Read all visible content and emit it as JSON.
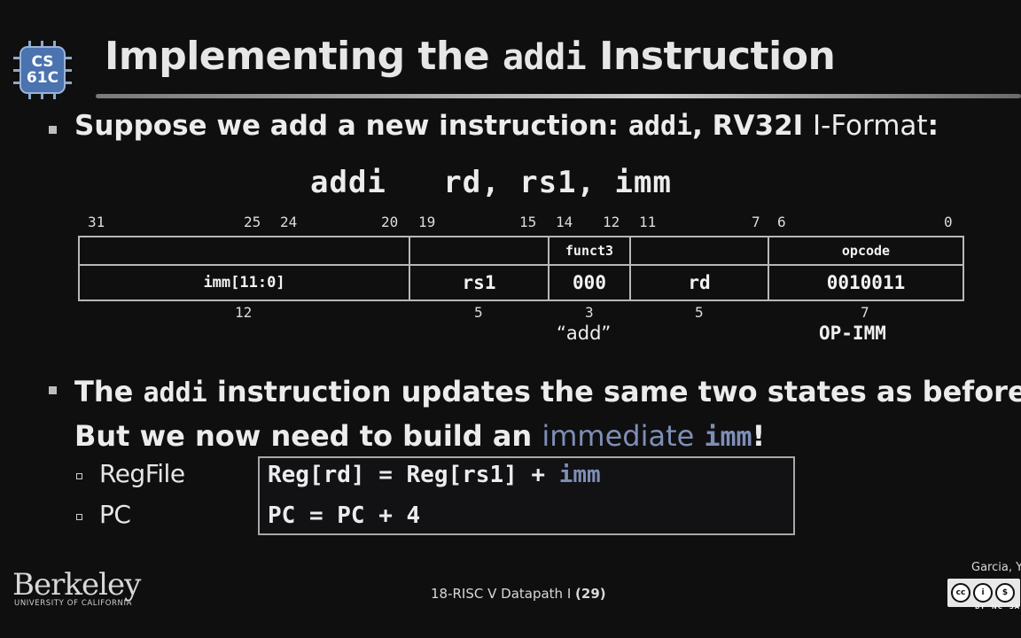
{
  "logo": {
    "line1": "CS",
    "line2": "61C"
  },
  "title": {
    "prefix": "Implementing the",
    "code": "addi",
    "suffix": "Instruction"
  },
  "bullet1": {
    "text": "Suppose we add a new instruction: ",
    "code": "addi",
    "mid": ", RV32I ",
    "thin": "I-Format",
    "end": ":"
  },
  "syntax": "addi   rd, rs1, imm",
  "format": {
    "bit_numbers": [
      "31",
      "25",
      "24",
      "20",
      "19",
      "15",
      "14",
      "12",
      "11",
      "7",
      "6",
      "0"
    ],
    "header_row": [
      "",
      "",
      "funct3",
      "",
      "opcode"
    ],
    "fields": [
      "imm[11:0]",
      "rs1",
      "000",
      "rd",
      "0010011"
    ],
    "widths": [
      "12",
      "5",
      "3",
      "5",
      "7"
    ],
    "funct3_note": "“add”",
    "opcode_note": "OP-IMM"
  },
  "bullet2": {
    "t1": "The ",
    "code": "addi",
    "t2": " instruction updates the same two states as before.",
    "t3": "But we now need to build an ",
    "imm_word": "immediate",
    "imm_code": "imm",
    "t4": "!"
  },
  "states": [
    {
      "label": "RegFile",
      "eq_main": "Reg[rd] = Reg[rs1] + ",
      "eq_imm": "imm"
    },
    {
      "label": "PC",
      "eq_main": "PC = PC + 4",
      "eq_imm": ""
    }
  ],
  "footer": {
    "institution": "Berkeley",
    "institution_sub": "UNIVERSITY OF CALIFORNIA",
    "lecture": "18-RISC V Datapath I",
    "page": "(29)",
    "author": "Garcia, Yo",
    "license_tags": "BY  NC  SA"
  },
  "colors": {
    "background": "#0f0f10",
    "accent_imm": "#7f8eb6",
    "logo_chip": "#4a73b0"
  }
}
